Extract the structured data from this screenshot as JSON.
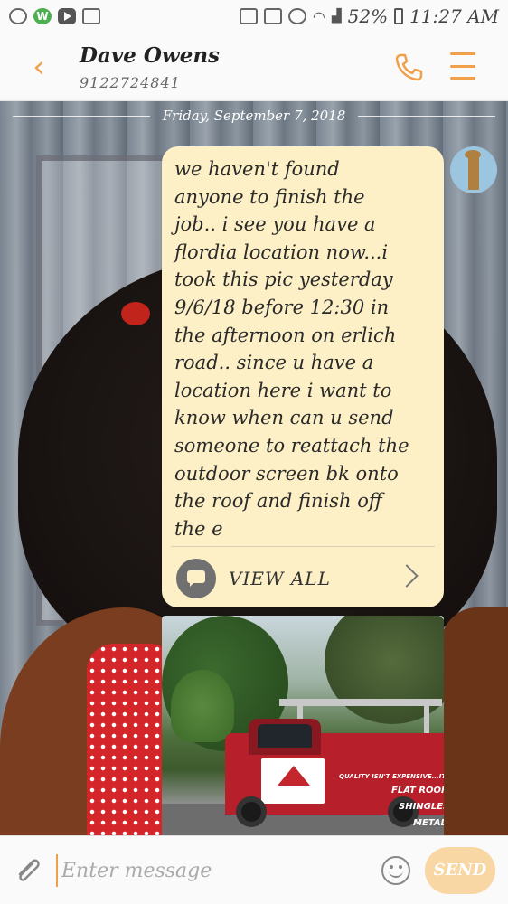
{
  "status_bar": {
    "battery": "52%",
    "time": "11:27 AM"
  },
  "header": {
    "contact_name": "Dave Owens",
    "contact_number": "9122724841",
    "back_icon": "chevron-left-icon",
    "call_icon": "phone-icon",
    "menu_icon": "hamburger-icon",
    "accent_color": "#f0a04b"
  },
  "conversation": {
    "date_divider": "Friday, September 7, 2018",
    "message": {
      "text": "we haven't found\nanyone to finish the\njob.. i see you have a\nflordia location now...i\ntook this pic yesterday\n9/6/18 before 12:30 in\nthe afternoon on erlich\nroad.. since u have a\nlocation here i want to\nknow when can u send\nsomeone to reattach the\noutdoor screen bk onto\nthe roof and finish off\nthe e",
      "view_all_label": "VIEW ALL",
      "bubble_color": "#fdf0c7"
    },
    "attachment": {
      "tagline": "QUALITY ISN'T EXPENSIVE...IT'S PRICELE",
      "line1": "FLAT ROOFS",
      "line2": "SHINGLES",
      "line3": "METAL"
    }
  },
  "composer": {
    "placeholder": "Enter message",
    "send_label": "SEND"
  }
}
